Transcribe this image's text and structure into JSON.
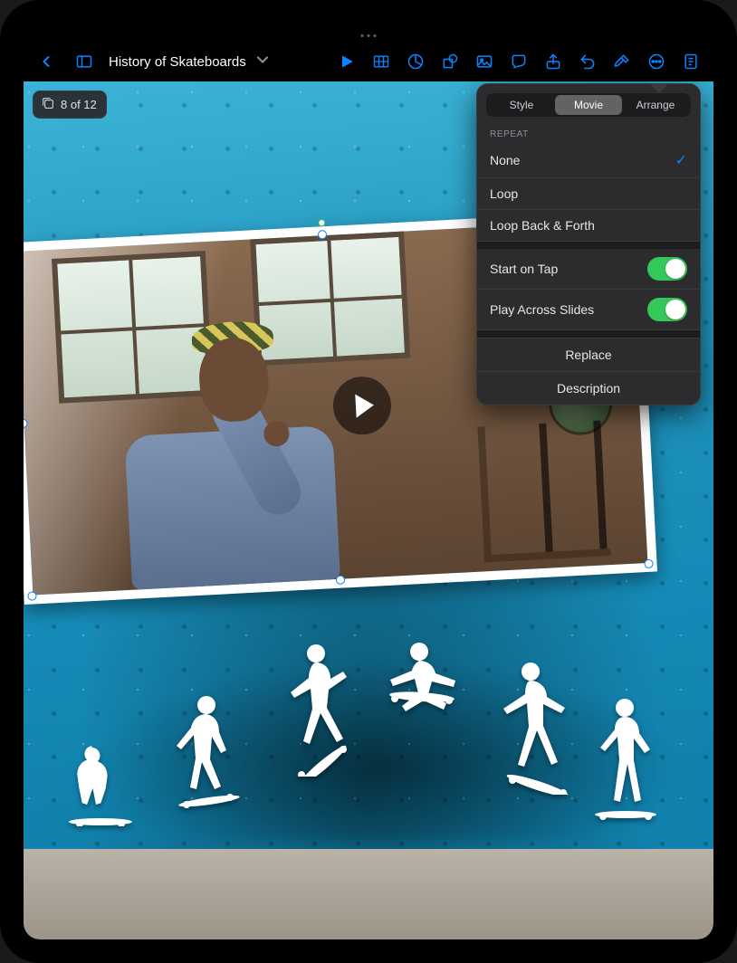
{
  "document": {
    "title": "History of Skateboards"
  },
  "slide_counter": {
    "text": "8 of 12"
  },
  "format_panel": {
    "tabs": {
      "style": "Style",
      "movie": "Movie",
      "arrange": "Arrange",
      "active": "movie"
    },
    "repeat": {
      "section_label": "REPEAT",
      "options": {
        "none": "None",
        "loop": "Loop",
        "back_forth": "Loop Back & Forth"
      },
      "selected": "none"
    },
    "toggles": {
      "start_on_tap": {
        "label": "Start on Tap",
        "value": true
      },
      "play_across_slides": {
        "label": "Play Across Slides",
        "value": true
      }
    },
    "actions": {
      "replace": "Replace",
      "description": "Description"
    }
  },
  "toolbar": {
    "icons": {
      "back": "back-icon",
      "sidebar": "sidebar-icon",
      "play": "play-icon",
      "table": "table-icon",
      "chart": "chart-icon",
      "shape": "shape-icon",
      "media": "media-icon",
      "comment": "comment-icon",
      "share": "share-icon",
      "undo": "undo-icon",
      "format": "format-paintbrush-icon",
      "more": "more-icon",
      "document": "document-settings-icon"
    }
  }
}
